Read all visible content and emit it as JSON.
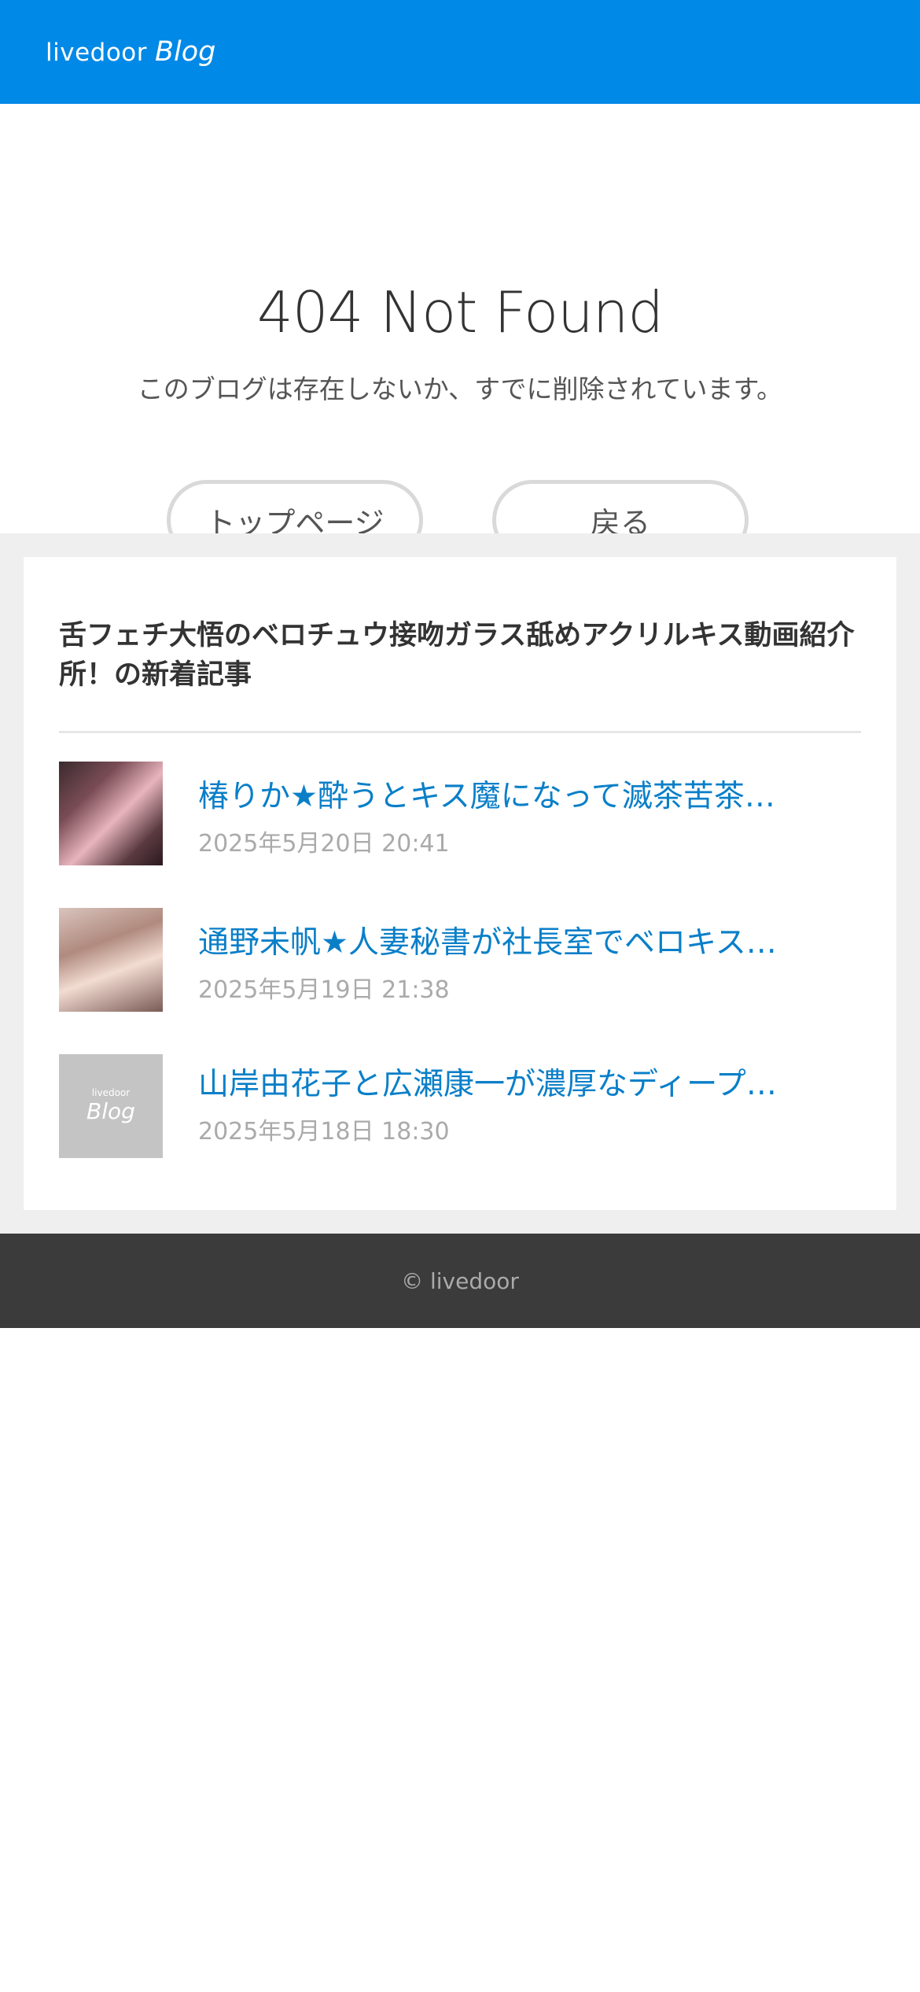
{
  "header": {
    "logo_livedoor": "livedoor",
    "logo_blog": "Blog"
  },
  "notfound": {
    "title": "404 Not Found",
    "message": "このブログは存在しないか、すでに削除されています。",
    "top_button_label": "トップページ",
    "back_button_label": "戻る"
  },
  "recent": {
    "heading": "舌フェチ大悟のベロチュウ接吻ガラス舐めアクリルキス動画紹介所！の新着記事",
    "articles": [
      {
        "title": "椿りか★酔うとキス魔になって滅茶苦茶…",
        "date": "2025年5月20日 20:41"
      },
      {
        "title": "通野未帆★人妻秘書が社長室でベロキス…",
        "date": "2025年5月19日 21:38"
      },
      {
        "title": "山岸由花子と広瀬康一が濃厚なディープ…",
        "date": "2025年5月18日 18:30",
        "placeholder_livedoor": "livedoor",
        "placeholder_blog": "Blog"
      }
    ]
  },
  "footer": {
    "copyright": "© livedoor"
  },
  "colors": {
    "header_bg": "#0089e6",
    "link": "#0a7fc8",
    "footer_bg": "#3b3b3b"
  }
}
